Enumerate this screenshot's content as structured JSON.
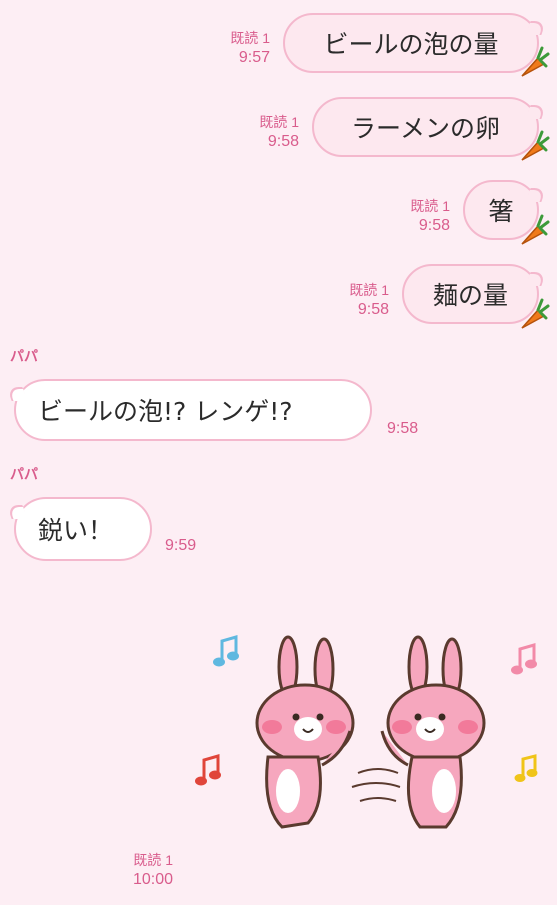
{
  "messages": [
    {
      "text": "ビールの泡の量",
      "read": "既読 1",
      "time": "9:57"
    },
    {
      "text": "ラーメンの卵",
      "read": "既読 1",
      "time": "9:58"
    },
    {
      "text": "箸",
      "read": "既読 1",
      "time": "9:58"
    },
    {
      "text": "麺の量",
      "read": "既読 1",
      "time": "9:58"
    }
  ],
  "incoming": [
    {
      "sender": "パパ",
      "text": "ビールの泡!?  レンゲ!?",
      "time": "9:58"
    },
    {
      "sender": "パパ",
      "text": "鋭い！",
      "time": "9:59"
    }
  ],
  "sticker_message": {
    "read": "既読 1",
    "time": "10:00"
  },
  "colors": {
    "background": "#fdeef4",
    "accent": "#d95c8c",
    "bubble_border": "#f4b8cd",
    "outgoing_bubble": "#fde8ef"
  },
  "icons": [
    "carrot-icon",
    "rabbit-sticker"
  ]
}
